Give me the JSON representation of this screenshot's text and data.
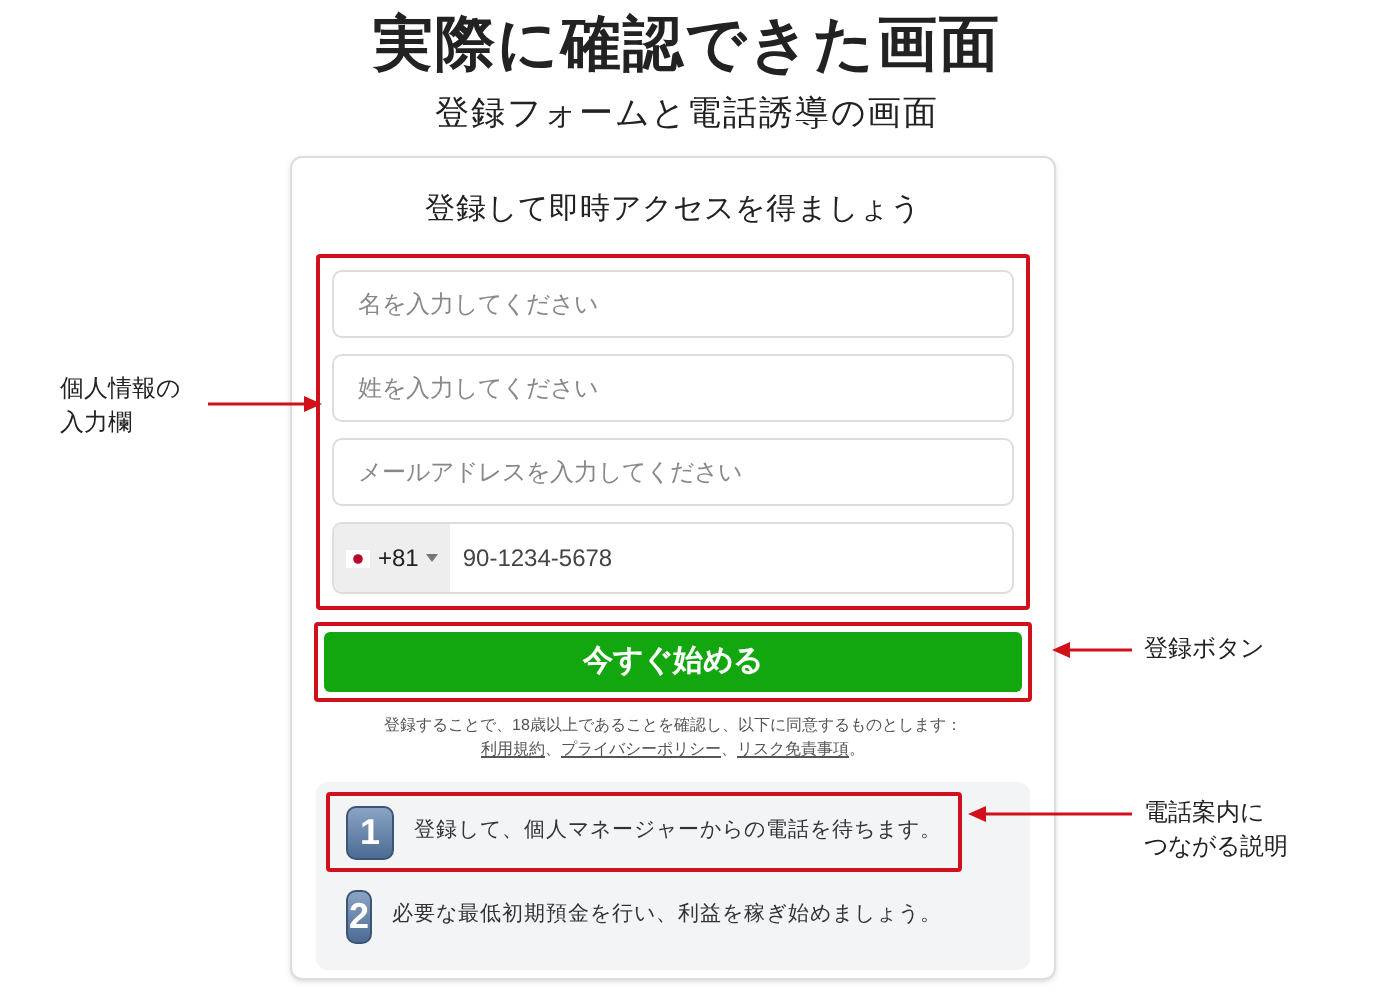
{
  "title": "実際に確認できた画面",
  "subtitle": "登録フォームと電話誘導の画面",
  "form": {
    "heading": "登録して即時アクセスを得ましょう",
    "fields_highlighted": true,
    "fields": [
      {
        "placeholder": "名を入力してください"
      },
      {
        "placeholder": "姓を入力してください"
      },
      {
        "placeholder": "メールアドレスを入力してください"
      }
    ],
    "phone": {
      "country_code": "+81",
      "value": "90-1234-5678"
    },
    "submit": {
      "label": "今すぐ始める",
      "highlighted": true
    },
    "disclaimer": "登録することで、18歳以上であることを確認し、以下に同意するものとします：",
    "links": [
      {
        "label": "利用規約",
        "after": "、"
      },
      {
        "label": "プライバシーポリシー",
        "after": "、"
      },
      {
        "label": "リスク免責事項",
        "after": "。"
      }
    ],
    "steps": [
      {
        "number": "1",
        "text": "登録して、個人マネージャーからの電話を待ちます。",
        "highlighted": true
      },
      {
        "number": "2",
        "text": "必要な最低初期預金を行い、利益を稼ぎ始めましょう。",
        "highlighted": false
      }
    ]
  },
  "annotations": [
    {
      "kind": "fields",
      "lines": [
        "個人情報の",
        "入力欄"
      ]
    },
    {
      "kind": "button",
      "lines": [
        "登録ボタン"
      ]
    },
    {
      "kind": "step",
      "lines": [
        "電話案内に",
        "つながる説明"
      ]
    }
  ]
}
